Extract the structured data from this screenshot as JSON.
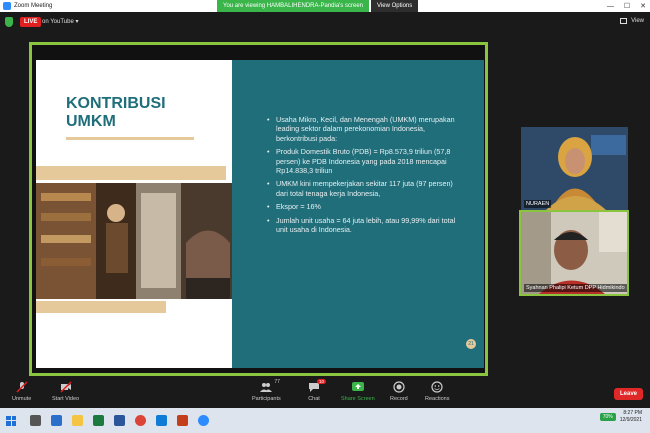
{
  "window": {
    "title": "Zoom Meeting"
  },
  "share_bar": {
    "viewing_text": "You are viewing HAMBALIHENDRA-Pandia's screen",
    "view_options": "View Options"
  },
  "topbar": {
    "live_label": "LIVE",
    "stream_target": "on YouTube",
    "view_label": "View"
  },
  "slide": {
    "heading": "KONTRIBUSI UMKM",
    "bullets": [
      "Usaha Mikro, Kecil, dan Menengah (UMKM) merupakan leading sektor dalam perekonomian Indonesia, berkontribusi pada:",
      "Produk Domestik Bruto (PDB) = Rp8.573,9 triliun (57,8 persen) ke PDB Indonesia yang pada 2018 mencapai Rp14.838,3 triliun",
      "UMKM kini mempekerjakan sekitar 117 juta (97 persen) dari total tenaga kerja Indonesia,",
      "Ekspor = 16%",
      "Jumlah unit usaha = 64 juta lebih, atau 99,99% dari total unit usaha di Indonesia."
    ],
    "page_number": "21"
  },
  "participants_videos": [
    {
      "name": "NURAEN"
    },
    {
      "name": "Syahnan Phalipi Ketum DPP Hidmikindo"
    }
  ],
  "toolbar": {
    "unmute": "Unmute",
    "start_video": "Start Video",
    "participants": "Participants",
    "participants_count": "77",
    "chat": "Chat",
    "chat_badge": "10",
    "share_screen": "Share Screen",
    "record": "Record",
    "reactions": "Reactions",
    "leave": "Leave"
  },
  "taskbar": {
    "battery": "70%",
    "time": "8:27 PM",
    "date": "12/9/2021"
  },
  "colors": {
    "accent_green": "#8bc53f",
    "teal": "#1f6e7a",
    "gold": "#e6c99a",
    "leave_red": "#e02828"
  }
}
